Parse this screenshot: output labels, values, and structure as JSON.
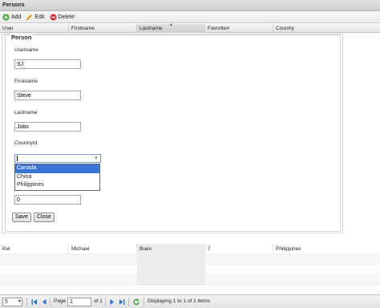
{
  "window": {
    "title": "Persons"
  },
  "toolbar": {
    "add_label": "Add",
    "edit_label": "Edit",
    "delete_label": "Delete"
  },
  "columns": [
    "User",
    "Firstname",
    "Lastname",
    "Favorite#",
    "Country"
  ],
  "form": {
    "legend": "Person",
    "username_label": "Username",
    "username_value": "SJ",
    "firstname_label": "Firstname",
    "firstname_value": "Steve",
    "lastname_label": "Lastname",
    "lastname_value": "Jobs",
    "countryid_label": "CountryId",
    "countryid_value": "",
    "country_options": [
      "Canada",
      "China",
      "Philippines"
    ],
    "favorite_value": "0",
    "save_label": "Save",
    "close_label": "Close"
  },
  "grid_rows": [
    [
      "Kel",
      "Michael",
      "Buen",
      "7",
      "Philippines"
    ]
  ],
  "pager": {
    "page_size": "5",
    "page_label": "Page",
    "page_value": "1",
    "of_label": "of 1",
    "display_text": "Displaying 1 to 1 of 1 items"
  },
  "colors": {
    "selected_option": "#3875d7",
    "title_bar": "#d8d8d8"
  }
}
